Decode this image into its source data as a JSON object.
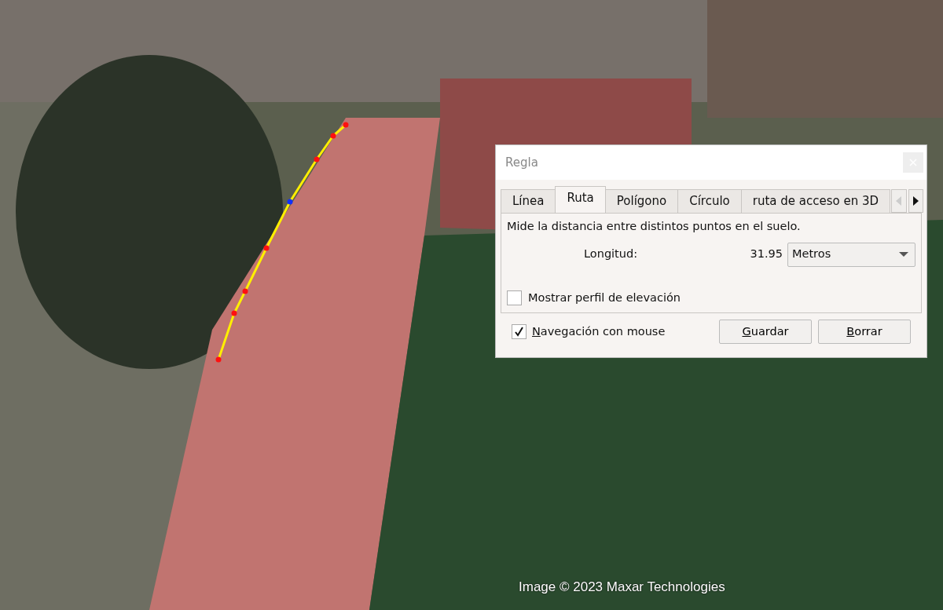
{
  "map": {
    "attribution": "Image © 2023 Maxar Technologies"
  },
  "dialog": {
    "title": "Regla",
    "tabs": [
      {
        "label": "Línea",
        "selected": false
      },
      {
        "label": "Ruta",
        "selected": true
      },
      {
        "label": "Polígono",
        "selected": false
      },
      {
        "label": "Círculo",
        "selected": false
      },
      {
        "label": "ruta de acceso en 3D",
        "selected": false
      }
    ],
    "description": "Mide la distancia entre distintos puntos en el suelo.",
    "length_label": "Longitud:",
    "length_value": "31.95",
    "unit": "Metros",
    "elevation_profile": {
      "label": "Mostrar perfil de elevación",
      "checked": false
    },
    "mouse_navigation": {
      "label": "Navegación con mouse",
      "checked": true
    },
    "buttons": [
      "Guardar",
      "Borrar"
    ]
  }
}
